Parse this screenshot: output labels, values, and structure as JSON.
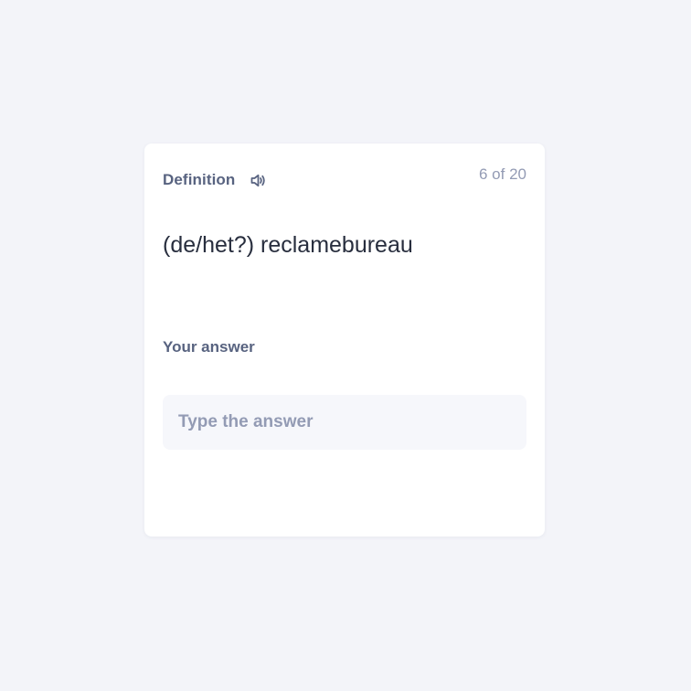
{
  "card": {
    "term_side_label": "Definition",
    "audio_icon": "speaker-icon",
    "progress": "6 of 20",
    "term": "(de/het?) reclamebureau",
    "answer_label": "Your answer",
    "answer_input": {
      "value": "",
      "placeholder": "Type the answer"
    }
  },
  "colors": {
    "background": "#f3f4f9",
    "card": "#ffffff",
    "label": "#586380",
    "muted": "#939bb4",
    "text": "#282e3e",
    "input_bg": "#f6f7fb"
  }
}
